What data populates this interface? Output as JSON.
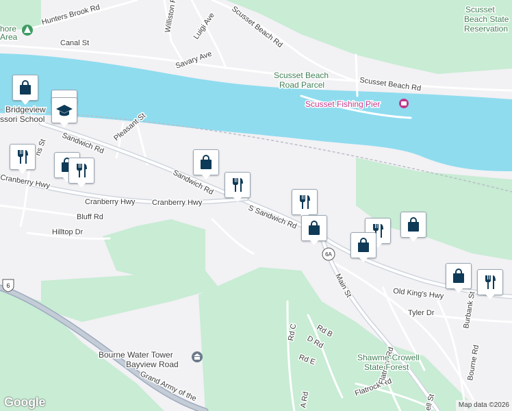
{
  "map": {
    "attribution": "Map data ©2026",
    "logo": "Google",
    "colors": {
      "land": "#f2f1f4",
      "water": "#8fdcef",
      "park": "#c8ecd4",
      "road": "#ffffff",
      "highway": "#c4ccd6",
      "marker_icon": "#0e3a57"
    }
  },
  "labels": {
    "hunters_brook": "Hunters Brook Rd",
    "williston": "Williston Rd",
    "luigi": "Luigi Ave",
    "canal_st": "Canal St",
    "savary": "Savary Ave",
    "scusset_beach_rd_top": "Scusset Beach Rd",
    "scusset_beach_rd_right": "Scusset Beach Rd",
    "scusset_reservation_1": "Scusset",
    "scusset_reservation_2": "Beach State",
    "scusset_reservation_3": "Reservation",
    "parcel_1": "Scusset Beach",
    "parcel_2": "Road Parcel",
    "fishing_pier": "Scusset Fishing Pier",
    "area_partial": "hore",
    "area_partial_2": "Area",
    "bridgeview_1": "Bridgeview",
    "bridgeview_2": "ssori School",
    "sandwich_rd_1": "Sandwich Rd",
    "sandwich_rd_2": "Sandwich Rd",
    "s_sandwich_rd": "S Sandwich Rd",
    "pleasant_st": "Pleasant St",
    "ns_st": "ns St",
    "cranberry_1": "Cranberry Hwy",
    "cranberry_2": "Cranberry Hwy",
    "cranberry_3": "Cranberry Hwy",
    "bluff_rd": "Bluff Rd",
    "hilltop_dr": "Hilltop Dr",
    "main_st": "Main St",
    "old_kings_hwy": "Old King's Hwy",
    "tyler_dr": "Tyler Dr",
    "burbank_st": "Burbank St",
    "bourne_rd": "Bourne Rd",
    "rd_c": "Rd C",
    "rd_b": "Rd B",
    "d_rd": "D Rd",
    "rd_e": "Rd E",
    "a_rd": "A Rd",
    "flatrock_rd": "Flatrock Rd",
    "ell_st": "ell St",
    "shawme_1": "Shawme-Crowell",
    "shawme_2": "State Forest",
    "water_tower_1": "Bourne Water Tower",
    "water_tower_2": "Bayview Road",
    "grand_army": "Grand Army of the",
    "route_6": "6",
    "route_6a": "6A"
  },
  "markers": [
    {
      "id": "shopping-1",
      "icon": "shopping-bag-icon"
    },
    {
      "id": "school-1",
      "icon": "school-icon"
    },
    {
      "id": "restaurant-1",
      "icon": "restaurant-icon"
    },
    {
      "id": "shopping-2",
      "icon": "shopping-bag-icon"
    },
    {
      "id": "restaurant-2",
      "icon": "restaurant-icon"
    },
    {
      "id": "shopping-3",
      "icon": "shopping-bag-icon"
    },
    {
      "id": "restaurant-3",
      "icon": "restaurant-icon"
    },
    {
      "id": "restaurant-4",
      "icon": "restaurant-icon"
    },
    {
      "id": "shopping-4",
      "icon": "shopping-bag-icon"
    },
    {
      "id": "restaurant-5",
      "icon": "restaurant-icon"
    },
    {
      "id": "shopping-5",
      "icon": "shopping-bag-icon"
    },
    {
      "id": "shopping-6",
      "icon": "shopping-bag-icon"
    },
    {
      "id": "shopping-7",
      "icon": "shopping-bag-icon"
    },
    {
      "id": "restaurant-6",
      "icon": "restaurant-icon"
    }
  ]
}
